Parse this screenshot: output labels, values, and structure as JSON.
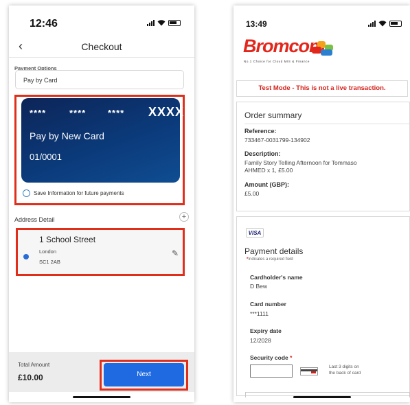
{
  "left_phone": {
    "status_time": "12:46",
    "nav": {
      "back_icon": "chevron-left-icon",
      "title": "Checkout"
    },
    "payment_options_label": "Payment Options",
    "payment_select_value": "Pay by Card",
    "card": {
      "mask_1": "****",
      "mask_2": "****",
      "mask_3": "****",
      "last_digits": "XXXX",
      "name": "Pay by New Card",
      "expiry": "01/0001"
    },
    "save_info_label": "Save Information for future payments",
    "address_detail_label": "Address Detail",
    "add_icon": "+",
    "address": {
      "street": "1 School Street",
      "city": "London",
      "postcode": "SC1 2AB"
    },
    "total_label": "Total Amount",
    "total_value": "£10.00",
    "next_button": "Next",
    "highlight_color": "#e02e1b",
    "accent_color": "#1f6ae0"
  },
  "right_phone": {
    "status_time": "13:49",
    "logo_text": "Bromcom",
    "logo_tagline": "No.1 Choice for Cloud MIS & Finance",
    "test_mode_banner": "Test Mode - This is not a live transaction.",
    "order_summary": {
      "title": "Order summary",
      "reference_label": "Reference:",
      "reference_value": "733467-0031799-134902",
      "description_label": "Description:",
      "description_line1": "Family Story Telling Afternoon for Tommaso",
      "description_line2": "AHMED x 1, £5.00",
      "amount_label": "Amount (GBP):",
      "amount_value": "£5.00"
    },
    "payment_details": {
      "card_brand": "VISA",
      "title": "Payment details",
      "required_note_star": "*",
      "required_note": "Indicates a required field",
      "cardholder_label": "Cardholder's name",
      "cardholder_value": "D Bew",
      "card_number_label": "Card number",
      "card_number_value": "***1111",
      "expiry_label": "Expiry date",
      "expiry_value": "12/2028",
      "security_label": "Security code",
      "security_required": "*",
      "security_hint_line1": "Last 3 digits on",
      "security_hint_line2": "the back of card"
    },
    "brand_color": "#e3261b"
  }
}
